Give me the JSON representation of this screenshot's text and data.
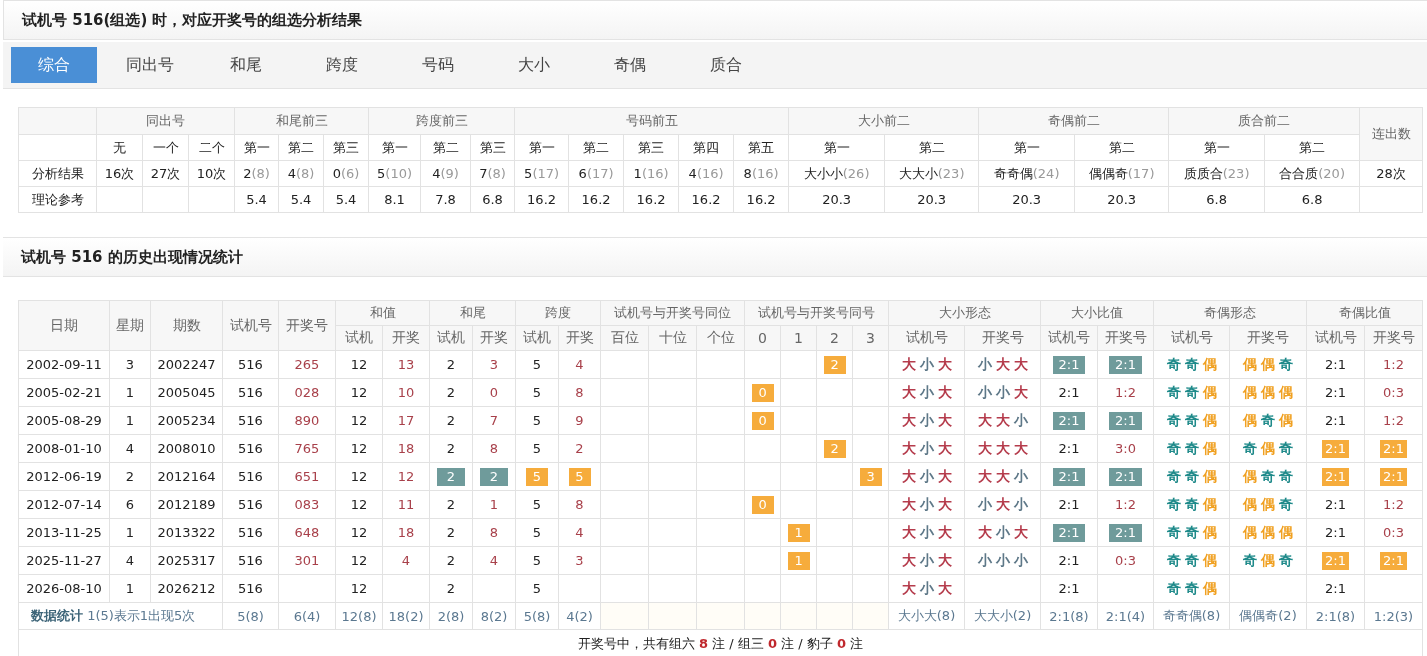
{
  "title": "试机号 516(组选) 时，对应开奖号的组选分析结果",
  "tabs": [
    {
      "label": "综合",
      "selected": true
    },
    {
      "label": "同出号",
      "selected": false
    },
    {
      "label": "和尾",
      "selected": false
    },
    {
      "label": "跨度",
      "selected": false
    },
    {
      "label": "号码",
      "selected": false
    },
    {
      "label": "大小",
      "selected": false
    },
    {
      "label": "奇偶",
      "selected": false
    },
    {
      "label": "质合",
      "selected": false
    }
  ],
  "summary_table": {
    "groups": [
      {
        "label": "同出号",
        "columns": [
          "无",
          "一个",
          "二个"
        ]
      },
      {
        "label": "和尾前三",
        "columns": [
          "第一",
          "第二",
          "第三"
        ]
      },
      {
        "label": "跨度前三",
        "columns": [
          "第一",
          "第二",
          "第三"
        ]
      },
      {
        "label": "号码前五",
        "columns": [
          "第一",
          "第二",
          "第三",
          "第四",
          "第五"
        ]
      },
      {
        "label": "大小前二",
        "columns": [
          "第一",
          "第二"
        ]
      },
      {
        "label": "奇偶前二",
        "columns": [
          "第一",
          "第二"
        ]
      },
      {
        "label": "质合前二",
        "columns": [
          "第一",
          "第二"
        ]
      }
    ],
    "last_column": "连出数",
    "rows": [
      {
        "label": "分析结果",
        "cells": [
          {
            "value": "16次"
          },
          {
            "value": "27次"
          },
          {
            "value": "10次"
          },
          {
            "value": "2",
            "count": "(8)"
          },
          {
            "value": "4",
            "count": "(8)"
          },
          {
            "value": "0",
            "count": "(6)"
          },
          {
            "value": "5",
            "count": "(10)"
          },
          {
            "value": "4",
            "count": "(9)"
          },
          {
            "value": "7",
            "count": "(8)"
          },
          {
            "value": "5",
            "count": "(17)"
          },
          {
            "value": "6",
            "count": "(17)"
          },
          {
            "value": "1",
            "count": "(16)"
          },
          {
            "value": "4",
            "count": "(16)"
          },
          {
            "value": "8",
            "count": "(16)"
          },
          {
            "value": "大小小",
            "count": "(26)"
          },
          {
            "value": "大大小",
            "count": "(23)"
          },
          {
            "value": "奇奇偶",
            "count": "(24)"
          },
          {
            "value": "偶偶奇",
            "count": "(17)"
          },
          {
            "value": "质质合",
            "count": "(23)"
          },
          {
            "value": "合合质",
            "count": "(20)"
          }
        ],
        "last": "28次"
      },
      {
        "label": "理论参考",
        "cells": [
          null,
          null,
          null,
          {
            "value": "5.4"
          },
          {
            "value": "5.4"
          },
          {
            "value": "5.4"
          },
          {
            "value": "8.1"
          },
          {
            "value": "7.8"
          },
          {
            "value": "6.8"
          },
          {
            "value": "16.2"
          },
          {
            "value": "16.2"
          },
          {
            "value": "16.2"
          },
          {
            "value": "16.2"
          },
          {
            "value": "16.2"
          },
          {
            "value": "20.3"
          },
          {
            "value": "20.3"
          },
          {
            "value": "20.3"
          },
          {
            "value": "20.3"
          },
          {
            "value": "6.8"
          },
          {
            "value": "6.8"
          }
        ]
      }
    ]
  },
  "history_title": "试机号 516 的历史出现情况统计",
  "history_table": {
    "header_rows": [
      [
        {
          "text": "日期",
          "rowspan": 2
        },
        {
          "text": "星期",
          "rowspan": 2
        },
        {
          "text": "期数",
          "rowspan": 2
        },
        {
          "text": "试机号",
          "rowspan": 2
        },
        {
          "text": "开奖号",
          "rowspan": 2
        },
        {
          "text": "和值",
          "colspan": 2
        },
        {
          "text": "和尾",
          "colspan": 2
        },
        {
          "text": "跨度",
          "colspan": 2
        },
        {
          "text": "试机号与开奖号同位",
          "colspan": 3
        },
        {
          "text": "试机号与开奖号同号",
          "colspan": 4
        },
        {
          "text": "大小形态",
          "colspan": 2
        },
        {
          "text": "大小比值",
          "colspan": 2
        },
        {
          "text": "奇偶形态",
          "colspan": 2
        },
        {
          "text": "奇偶比值",
          "colspan": 2
        }
      ],
      [
        {
          "text": "试机"
        },
        {
          "text": "开奖"
        },
        {
          "text": "试机"
        },
        {
          "text": "开奖"
        },
        {
          "text": "试机"
        },
        {
          "text": "开奖"
        },
        {
          "text": "百位"
        },
        {
          "text": "十位"
        },
        {
          "text": "个位"
        },
        {
          "text": "0"
        },
        {
          "text": "1"
        },
        {
          "text": "2"
        },
        {
          "text": "3"
        },
        {
          "text": "试机号"
        },
        {
          "text": "开奖号"
        },
        {
          "text": "试机号"
        },
        {
          "text": "开奖号"
        },
        {
          "text": "试机号"
        },
        {
          "text": "开奖号"
        },
        {
          "text": "试机号"
        },
        {
          "text": "开奖号"
        }
      ]
    ],
    "rows": [
      {
        "cells": [
          "2002-09-11",
          "3",
          "2002247",
          "516",
          {
            "text": "265",
            "kind": "win"
          },
          "12",
          {
            "text": "13",
            "kind": "win"
          },
          "2",
          {
            "text": "3",
            "kind": "win"
          },
          "5",
          {
            "text": "4",
            "kind": "win"
          },
          null,
          null,
          null,
          null,
          null,
          {
            "text": "2",
            "kind": "orange"
          },
          null,
          {
            "kind": "shape",
            "chars": [
              {
                "text": "大",
                "color": "#b53c4c"
              },
              {
                "text": "小",
                "color": "#5e7888"
              },
              {
                "text": "大",
                "color": "#b53c4c"
              }
            ]
          },
          {
            "kind": "shape",
            "chars": [
              {
                "text": "小",
                "color": "#5e7888"
              },
              {
                "text": "大",
                "color": "#b53c4c"
              },
              {
                "text": "大",
                "color": "#b53c4c"
              }
            ]
          },
          {
            "text": "2:1",
            "kind": "teal"
          },
          {
            "text": "2:1",
            "kind": "teal"
          },
          {
            "kind": "shape",
            "chars": [
              {
                "text": "奇",
                "color": "#1f8a8a"
              },
              {
                "text": "奇",
                "color": "#1f8a8a"
              },
              {
                "text": "偶",
                "color": "#f0a020"
              }
            ]
          },
          {
            "kind": "shape",
            "chars": [
              {
                "text": "偶",
                "color": "#f0a020"
              },
              {
                "text": "偶",
                "color": "#f0a020"
              },
              {
                "text": "奇",
                "color": "#1f8a8a"
              }
            ]
          },
          "2:1",
          {
            "text": "1:2",
            "kind": "win"
          }
        ]
      },
      {
        "cells": [
          "2005-02-21",
          "1",
          "2005045",
          "516",
          {
            "text": "028",
            "kind": "win"
          },
          "12",
          {
            "text": "10",
            "kind": "win"
          },
          "2",
          {
            "text": "0",
            "kind": "win"
          },
          "5",
          {
            "text": "8",
            "kind": "win"
          },
          null,
          null,
          null,
          {
            "text": "0",
            "kind": "orange"
          },
          null,
          null,
          null,
          {
            "kind": "shape",
            "chars": [
              {
                "text": "大",
                "color": "#b53c4c"
              },
              {
                "text": "小",
                "color": "#5e7888"
              },
              {
                "text": "大",
                "color": "#b53c4c"
              }
            ]
          },
          {
            "kind": "shape",
            "chars": [
              {
                "text": "小",
                "color": "#5e7888"
              },
              {
                "text": "小",
                "color": "#5e7888"
              },
              {
                "text": "大",
                "color": "#b53c4c"
              }
            ]
          },
          "2:1",
          {
            "text": "1:2",
            "kind": "win"
          },
          {
            "kind": "shape",
            "chars": [
              {
                "text": "奇",
                "color": "#1f8a8a"
              },
              {
                "text": "奇",
                "color": "#1f8a8a"
              },
              {
                "text": "偶",
                "color": "#f0a020"
              }
            ]
          },
          {
            "kind": "shape",
            "chars": [
              {
                "text": "偶",
                "color": "#f0a020"
              },
              {
                "text": "偶",
                "color": "#f0a020"
              },
              {
                "text": "偶",
                "color": "#f0a020"
              }
            ]
          },
          "2:1",
          {
            "text": "0:3",
            "kind": "win"
          }
        ]
      },
      {
        "cells": [
          "2005-08-29",
          "1",
          "2005234",
          "516",
          {
            "text": "890",
            "kind": "win"
          },
          "12",
          {
            "text": "17",
            "kind": "win"
          },
          "2",
          {
            "text": "7",
            "kind": "win"
          },
          "5",
          {
            "text": "9",
            "kind": "win"
          },
          null,
          null,
          null,
          {
            "text": "0",
            "kind": "orange"
          },
          null,
          null,
          null,
          {
            "kind": "shape",
            "chars": [
              {
                "text": "大",
                "color": "#b53c4c"
              },
              {
                "text": "小",
                "color": "#5e7888"
              },
              {
                "text": "大",
                "color": "#b53c4c"
              }
            ]
          },
          {
            "kind": "shape",
            "chars": [
              {
                "text": "大",
                "color": "#b53c4c"
              },
              {
                "text": "大",
                "color": "#b53c4c"
              },
              {
                "text": "小",
                "color": "#5e7888"
              }
            ]
          },
          {
            "text": "2:1",
            "kind": "teal"
          },
          {
            "text": "2:1",
            "kind": "teal"
          },
          {
            "kind": "shape",
            "chars": [
              {
                "text": "奇",
                "color": "#1f8a8a"
              },
              {
                "text": "奇",
                "color": "#1f8a8a"
              },
              {
                "text": "偶",
                "color": "#f0a020"
              }
            ]
          },
          {
            "kind": "shape",
            "chars": [
              {
                "text": "偶",
                "color": "#f0a020"
              },
              {
                "text": "奇",
                "color": "#1f8a8a"
              },
              {
                "text": "偶",
                "color": "#f0a020"
              }
            ]
          },
          "2:1",
          {
            "text": "1:2",
            "kind": "win"
          }
        ]
      },
      {
        "cells": [
          "2008-01-10",
          "4",
          "2008010",
          "516",
          {
            "text": "765",
            "kind": "win"
          },
          "12",
          {
            "text": "18",
            "kind": "win"
          },
          "2",
          {
            "text": "8",
            "kind": "win"
          },
          "5",
          {
            "text": "2",
            "kind": "win"
          },
          null,
          null,
          null,
          null,
          null,
          {
            "text": "2",
            "kind": "orange"
          },
          null,
          {
            "kind": "shape",
            "chars": [
              {
                "text": "大",
                "color": "#b53c4c"
              },
              {
                "text": "小",
                "color": "#5e7888"
              },
              {
                "text": "大",
                "color": "#b53c4c"
              }
            ]
          },
          {
            "kind": "shape",
            "chars": [
              {
                "text": "大",
                "color": "#b53c4c"
              },
              {
                "text": "大",
                "color": "#b53c4c"
              },
              {
                "text": "大",
                "color": "#b53c4c"
              }
            ]
          },
          "2:1",
          {
            "text": "3:0",
            "kind": "win"
          },
          {
            "kind": "shape",
            "chars": [
              {
                "text": "奇",
                "color": "#1f8a8a"
              },
              {
                "text": "奇",
                "color": "#1f8a8a"
              },
              {
                "text": "偶",
                "color": "#f0a020"
              }
            ]
          },
          {
            "kind": "shape",
            "chars": [
              {
                "text": "奇",
                "color": "#1f8a8a"
              },
              {
                "text": "偶",
                "color": "#f0a020"
              },
              {
                "text": "奇",
                "color": "#1f8a8a"
              }
            ]
          },
          {
            "text": "2:1",
            "kind": "orange"
          },
          {
            "text": "2:1",
            "kind": "orange"
          }
        ]
      },
      {
        "cells": [
          "2012-06-19",
          "2",
          "2012164",
          "516",
          {
            "text": "651",
            "kind": "win"
          },
          "12",
          {
            "text": "12",
            "kind": "win"
          },
          {
            "text": "2",
            "kind": "teal"
          },
          {
            "text": "2",
            "kind": "teal"
          },
          {
            "text": "5",
            "kind": "orange"
          },
          {
            "text": "5",
            "kind": "orange"
          },
          null,
          null,
          null,
          null,
          null,
          null,
          {
            "text": "3",
            "kind": "orange"
          },
          {
            "kind": "shape",
            "chars": [
              {
                "text": "大",
                "color": "#b53c4c"
              },
              {
                "text": "小",
                "color": "#5e7888"
              },
              {
                "text": "大",
                "color": "#b53c4c"
              }
            ]
          },
          {
            "kind": "shape",
            "chars": [
              {
                "text": "大",
                "color": "#b53c4c"
              },
              {
                "text": "大",
                "color": "#b53c4c"
              },
              {
                "text": "小",
                "color": "#5e7888"
              }
            ]
          },
          {
            "text": "2:1",
            "kind": "teal"
          },
          {
            "text": "2:1",
            "kind": "teal"
          },
          {
            "kind": "shape",
            "chars": [
              {
                "text": "奇",
                "color": "#1f8a8a"
              },
              {
                "text": "奇",
                "color": "#1f8a8a"
              },
              {
                "text": "偶",
                "color": "#f0a020"
              }
            ]
          },
          {
            "kind": "shape",
            "chars": [
              {
                "text": "偶",
                "color": "#f0a020"
              },
              {
                "text": "奇",
                "color": "#1f8a8a"
              },
              {
                "text": "奇",
                "color": "#1f8a8a"
              }
            ]
          },
          {
            "text": "2:1",
            "kind": "orange"
          },
          {
            "text": "2:1",
            "kind": "orange"
          }
        ]
      },
      {
        "cells": [
          "2012-07-14",
          "6",
          "2012189",
          "516",
          {
            "text": "083",
            "kind": "win"
          },
          "12",
          {
            "text": "11",
            "kind": "win"
          },
          "2",
          {
            "text": "1",
            "kind": "win"
          },
          "5",
          {
            "text": "8",
            "kind": "win"
          },
          null,
          null,
          null,
          {
            "text": "0",
            "kind": "orange"
          },
          null,
          null,
          null,
          {
            "kind": "shape",
            "chars": [
              {
                "text": "大",
                "color": "#b53c4c"
              },
              {
                "text": "小",
                "color": "#5e7888"
              },
              {
                "text": "大",
                "color": "#b53c4c"
              }
            ]
          },
          {
            "kind": "shape",
            "chars": [
              {
                "text": "小",
                "color": "#5e7888"
              },
              {
                "text": "大",
                "color": "#b53c4c"
              },
              {
                "text": "小",
                "color": "#5e7888"
              }
            ]
          },
          "2:1",
          {
            "text": "1:2",
            "kind": "win"
          },
          {
            "kind": "shape",
            "chars": [
              {
                "text": "奇",
                "color": "#1f8a8a"
              },
              {
                "text": "奇",
                "color": "#1f8a8a"
              },
              {
                "text": "偶",
                "color": "#f0a020"
              }
            ]
          },
          {
            "kind": "shape",
            "chars": [
              {
                "text": "偶",
                "color": "#f0a020"
              },
              {
                "text": "偶",
                "color": "#f0a020"
              },
              {
                "text": "奇",
                "color": "#1f8a8a"
              }
            ]
          },
          "2:1",
          {
            "text": "1:2",
            "kind": "win"
          }
        ]
      },
      {
        "cells": [
          "2013-11-25",
          "1",
          "2013322",
          "516",
          {
            "text": "648",
            "kind": "win"
          },
          "12",
          {
            "text": "18",
            "kind": "win"
          },
          "2",
          {
            "text": "8",
            "kind": "win"
          },
          "5",
          {
            "text": "4",
            "kind": "win"
          },
          null,
          null,
          null,
          null,
          {
            "text": "1",
            "kind": "orange"
          },
          null,
          null,
          {
            "kind": "shape",
            "chars": [
              {
                "text": "大",
                "color": "#b53c4c"
              },
              {
                "text": "小",
                "color": "#5e7888"
              },
              {
                "text": "大",
                "color": "#b53c4c"
              }
            ]
          },
          {
            "kind": "shape",
            "chars": [
              {
                "text": "大",
                "color": "#b53c4c"
              },
              {
                "text": "小",
                "color": "#5e7888"
              },
              {
                "text": "大",
                "color": "#b53c4c"
              }
            ]
          },
          {
            "text": "2:1",
            "kind": "teal"
          },
          {
            "text": "2:1",
            "kind": "teal"
          },
          {
            "kind": "shape",
            "chars": [
              {
                "text": "奇",
                "color": "#1f8a8a"
              },
              {
                "text": "奇",
                "color": "#1f8a8a"
              },
              {
                "text": "偶",
                "color": "#f0a020"
              }
            ]
          },
          {
            "kind": "shape",
            "chars": [
              {
                "text": "偶",
                "color": "#f0a020"
              },
              {
                "text": "偶",
                "color": "#f0a020"
              },
              {
                "text": "偶",
                "color": "#f0a020"
              }
            ]
          },
          "2:1",
          {
            "text": "0:3",
            "kind": "win"
          }
        ]
      },
      {
        "cells": [
          "2025-11-27",
          "4",
          "2025317",
          "516",
          {
            "text": "301",
            "kind": "win"
          },
          "12",
          {
            "text": "4",
            "kind": "win"
          },
          "2",
          {
            "text": "4",
            "kind": "win"
          },
          "5",
          {
            "text": "3",
            "kind": "win"
          },
          null,
          null,
          null,
          null,
          {
            "text": "1",
            "kind": "orange"
          },
          null,
          null,
          {
            "kind": "shape",
            "chars": [
              {
                "text": "大",
                "color": "#b53c4c"
              },
              {
                "text": "小",
                "color": "#5e7888"
              },
              {
                "text": "大",
                "color": "#b53c4c"
              }
            ]
          },
          {
            "kind": "shape",
            "chars": [
              {
                "text": "小",
                "color": "#5e7888"
              },
              {
                "text": "小",
                "color": "#5e7888"
              },
              {
                "text": "小",
                "color": "#5e7888"
              }
            ]
          },
          "2:1",
          {
            "text": "0:3",
            "kind": "win"
          },
          {
            "kind": "shape",
            "chars": [
              {
                "text": "奇",
                "color": "#1f8a8a"
              },
              {
                "text": "奇",
                "color": "#1f8a8a"
              },
              {
                "text": "偶",
                "color": "#f0a020"
              }
            ]
          },
          {
            "kind": "shape",
            "chars": [
              {
                "text": "奇",
                "color": "#1f8a8a"
              },
              {
                "text": "偶",
                "color": "#f0a020"
              },
              {
                "text": "奇",
                "color": "#1f8a8a"
              }
            ]
          },
          {
            "text": "2:1",
            "kind": "orange"
          },
          {
            "text": "2:1",
            "kind": "orange"
          }
        ]
      },
      {
        "cells": [
          "2026-08-10",
          "1",
          "2026212",
          "516",
          null,
          "12",
          null,
          "2",
          null,
          "5",
          null,
          null,
          null,
          null,
          null,
          null,
          null,
          null,
          {
            "kind": "shape",
            "chars": [
              {
                "text": "大",
                "color": "#b53c4c"
              },
              {
                "text": "小",
                "color": "#5e7888"
              },
              {
                "text": "大",
                "color": "#b53c4c"
              }
            ]
          },
          null,
          "2:1",
          null,
          {
            "kind": "shape",
            "chars": [
              {
                "text": "奇",
                "color": "#1f8a8a"
              },
              {
                "text": "奇",
                "color": "#1f8a8a"
              },
              {
                "text": "偶",
                "color": "#f0a020"
              }
            ]
          },
          null,
          "2:1",
          null
        ]
      }
    ],
    "summary": {
      "title": "数据统计",
      "note": "1(5)表示1出现5次",
      "cells": [
        "5(8)",
        "6(4)",
        "12(8)",
        "18(2)",
        "2(8)",
        "8(2)",
        "5(8)",
        "4(2)",
        null,
        null,
        null,
        null,
        null,
        null,
        null,
        "大小大(8)",
        "大大小(2)",
        "2:1(8)",
        "2:1(4)",
        "奇奇偶(8)",
        "偶偶奇(2)",
        "2:1(8)",
        "1:2(3)"
      ]
    },
    "footer": "开奖号中，共有组六 **8** 注 / 组三 **0** 注 / 豹子 **0** 注"
  }
}
